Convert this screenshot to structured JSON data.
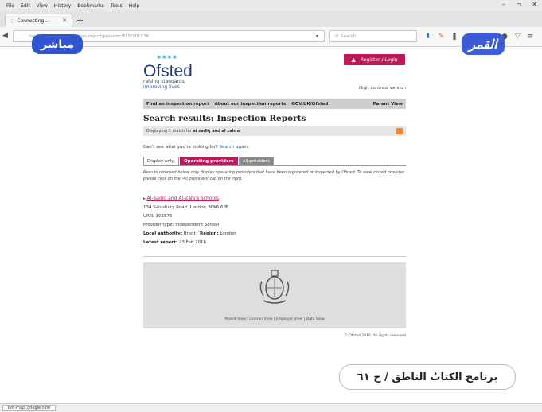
{
  "browser": {
    "menu": [
      "File",
      "Edit",
      "View",
      "History",
      "Bookmarks",
      "Tools",
      "Help"
    ],
    "tab_title": "Connecting...",
    "url": "...ion-reports/find-inspection-report/provider/ELS/101576",
    "search_placeholder": "Search",
    "status_url": "bot-mapi.google.com"
  },
  "overlay": {
    "live_badge": "مباشر",
    "channel_logo": "القمر",
    "caption": "برنامج الكتابُ الناطق / ح ٦١"
  },
  "site": {
    "logo": "Ofsted",
    "tagline_1": "raising standards",
    "tagline_2": "improving lives",
    "register": "Register / Login",
    "high_contrast": "High contrast version",
    "nav": [
      "Find an inspection report",
      "About our inspection reports",
      "GOV.UK/Ofsted"
    ],
    "nav_right": "Parent View",
    "title": "Search results: Inspection Reports",
    "results_line_prefix": "Displaying 1 match for",
    "results_query": "al sadiq and al zahra",
    "cant_see": "Can't see what you're looking for?",
    "search_again": "Search again.",
    "tabs": [
      "Display only:",
      "Operating providers",
      "All providers"
    ],
    "description": "Results returned below only display operating providers that have been registered or inspected by Ofsted. To view closed provider please click on the 'All providers' tab on the right.",
    "result": {
      "name": "Al-Sadiq and Al-Zahra Schools",
      "address": "134 Salusbury Road, London, NW6 6PF",
      "urn": "URN: 101576",
      "provider_type": "Provider type: Independent School",
      "local_authority_label": "Local authority:",
      "local_authority": "Brent",
      "region_label": "Region:",
      "region": "London",
      "latest_label": "Latest report:",
      "latest": "23 Feb 2016"
    },
    "footer_links": "Parent View | Learner View | Employer View | Data View",
    "copyright": "© Ofsted 2016. All rights reserved"
  }
}
